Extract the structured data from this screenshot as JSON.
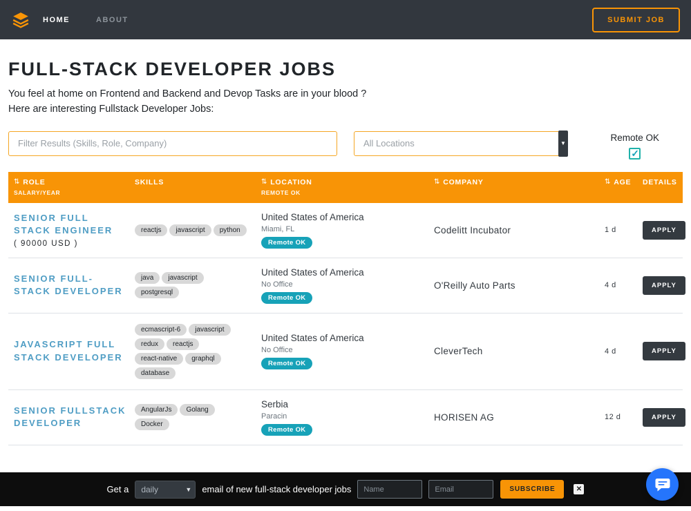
{
  "navbar": {
    "brand_icon": "layers-icon",
    "links": [
      {
        "label": "HOME",
        "active": true
      },
      {
        "label": "ABOUT",
        "active": false
      }
    ],
    "submit_label": "SUBMIT JOB"
  },
  "header": {
    "title": "FULL-STACK DEVELOPER JOBS",
    "subtitle1": "You feel at home on Frontend and Backend and Devop Tasks are in your blood ?",
    "subtitle2": "Here are interesting Fullstack Developer Jobs:"
  },
  "filters": {
    "search_placeholder": "Filter Results (Skills, Role, Company)",
    "location_value": "All Locations",
    "remote_label": "Remote OK",
    "remote_checked": true
  },
  "icons": {
    "sort": "⇅",
    "caret": "▼",
    "close": "✕"
  },
  "table": {
    "headers": {
      "role": "ROLE",
      "role_sub": "SALARY/YEAR",
      "skills": "SKILLS",
      "location": "LOCATION",
      "location_sub": "REMOTE OK",
      "company": "COMPANY",
      "age": "AGE",
      "details": "DETAILS"
    },
    "apply_label": "APPLY",
    "rows": [
      {
        "role": "SENIOR FULL STACK ENGINEER",
        "salary": "( 90000 USD )",
        "skills": [
          "reactjs",
          "javascript",
          "python"
        ],
        "country": "United States of America",
        "city": "Miami, FL",
        "remote_badge": "Remote OK",
        "company": "Codelitt Incubator",
        "age": "1 d"
      },
      {
        "role": "SENIOR FULL-STACK DEVELOPER",
        "salary": "",
        "skills": [
          "java",
          "javascript",
          "postgresql"
        ],
        "country": "United States of America",
        "city": "No Office",
        "remote_badge": "Remote OK",
        "company": "O'Reilly Auto Parts",
        "age": "4 d"
      },
      {
        "role": "JAVASCRIPT FULL STACK DEVELOPER",
        "salary": "",
        "skills": [
          "ecmascript-6",
          "javascript",
          "redux",
          "reactjs",
          "react-native",
          "graphql",
          "database"
        ],
        "country": "United States of America",
        "city": "No Office",
        "remote_badge": "Remote OK",
        "company": "CleverTech",
        "age": "4 d"
      },
      {
        "role": "SENIOR FULLSTACK DEVELOPER",
        "salary": "",
        "skills": [
          "AngularJs",
          "Golang",
          "Docker"
        ],
        "country": "Serbia",
        "city": "Paracin",
        "remote_badge": "Remote OK",
        "company": "HORISEN AG",
        "age": "12 d"
      }
    ]
  },
  "footer": {
    "prefix": "Get a",
    "frequency": "daily",
    "suffix": "email of new full-stack developer jobs",
    "name_placeholder": "Name",
    "email_placeholder": "Email",
    "subscribe_label": "SUBSCRIBE"
  },
  "colors": {
    "orange": "#f89406",
    "navbar_bg": "#32373e",
    "teal_badge": "#17a2b8",
    "role_blue": "#4f9dc4",
    "footer_bg": "#0d0d0d",
    "chat_blue": "#2575fc"
  }
}
